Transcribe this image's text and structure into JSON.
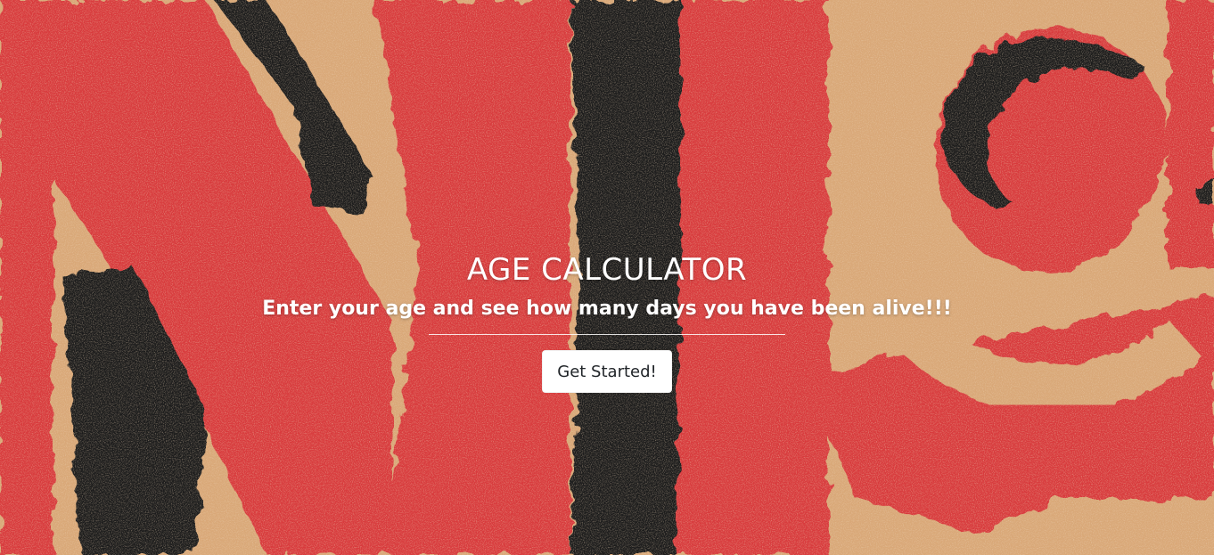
{
  "hero": {
    "title": "AGE CALCULATOR",
    "subtitle": "Enter your age and see how many days you have been alive!!!",
    "button_label": "Get Started!"
  },
  "colors": {
    "paint_red": "#d83a3e",
    "paint_tan": "#d9a878",
    "paint_black": "#1c1c1e",
    "text": "#ffffff",
    "button_bg": "#ffffff",
    "button_text": "#212529"
  }
}
